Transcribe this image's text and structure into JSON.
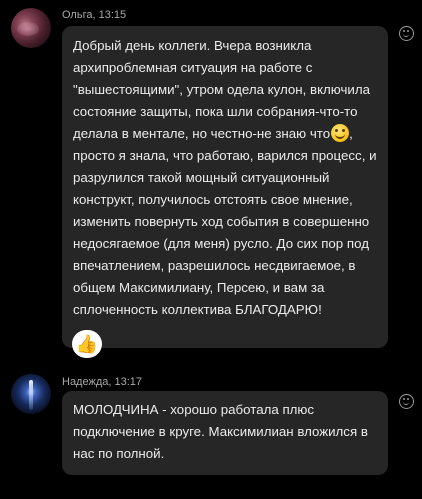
{
  "messages": [
    {
      "author": "Ольга, 13:15",
      "text_before_emoji": "Добрый день коллеги. Вчера возникла\nархипроблемная ситуация на работе с\n\"вышестоящими\", утром одела кулон, включила\nсостояние защиты, пока шли собрания-что-то\nделала в ментале, но честно-не знаю что",
      "emoji": "smile-emoji",
      "text_after_emoji": ",\nпросто я знала, что работаю, варился процесс, и\nразрулился такой мощный ситуационный\nконструкт, получилось отстоять свое мнение,\nизменить повернуть ход события в совершенно\nнедосягаемое (для меня) русло. До сих пор под\nвпечатлением, разрешилось несдвигаемое, в\nобщем Максимилиану,  Персею, и вам за\nсплоченность коллектива БЛАГОДАРЮ!",
      "reaction": "👍",
      "reaction_icon": "thumbs-up-icon"
    },
    {
      "author": "Надежда, 13:17",
      "text": "МОЛОДЧИНА  - хорошо работала плюс\nподключение в круге. Максимилиан вложился в\nнас по полной."
    }
  ],
  "icons": {
    "add_reaction": "smiley-icon"
  },
  "colors": {
    "background": "#000000",
    "bubble": "#262626",
    "author_text": "#a9a9a9",
    "message_text": "#ececec"
  }
}
